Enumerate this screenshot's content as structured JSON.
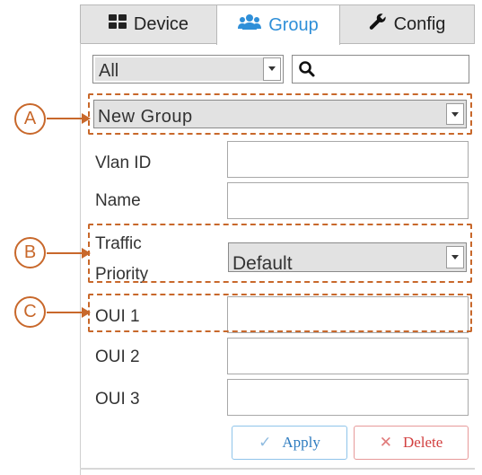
{
  "tabs": {
    "device": {
      "label": "Device",
      "icon": "grid-icon"
    },
    "group": {
      "label": "Group",
      "icon": "users-icon",
      "active": true
    },
    "config": {
      "label": "Config",
      "icon": "wrench-icon"
    }
  },
  "filter": {
    "selected": "All",
    "search_value": ""
  },
  "group_select": {
    "selected": "New Group"
  },
  "form": {
    "vlan_id": {
      "label": "Vlan ID",
      "value": ""
    },
    "name": {
      "label": "Name",
      "value": ""
    },
    "traffic_priority": {
      "label_line1": "Traffic",
      "label_line2": "Priority",
      "selected": "Default"
    },
    "oui1": {
      "label": "OUI 1",
      "value": ""
    },
    "oui2": {
      "label": "OUI 2",
      "value": ""
    },
    "oui3": {
      "label": "OUI 3",
      "value": ""
    }
  },
  "buttons": {
    "apply": {
      "label": "Apply",
      "glyph": "✓"
    },
    "delete": {
      "label": "Delete",
      "glyph": "✕"
    }
  },
  "annotations": {
    "a": "A",
    "b": "B",
    "c": "C"
  },
  "colors": {
    "accent": "#2f8fd8",
    "annotation": "#c8682b",
    "apply": "#2e7cc0",
    "delete": "#d24040"
  }
}
